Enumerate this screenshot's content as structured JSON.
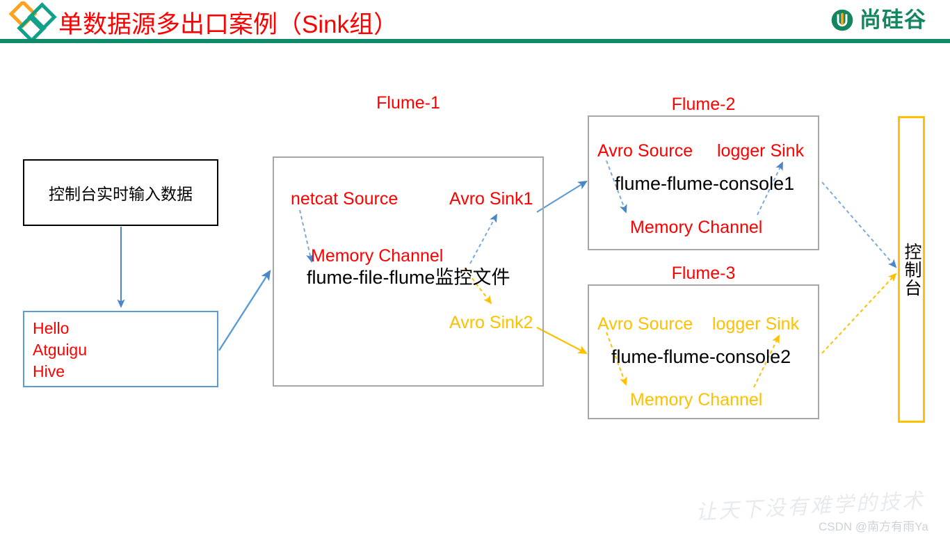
{
  "header": {
    "title": "单数据源多出口案例（Sink组）",
    "brand_logo_text": "尚硅谷",
    "brand_logo_mark": "u-circle-icon",
    "rule_color": "#0e8a6b",
    "title_color": "#ff0000",
    "brand_color": "#13855f",
    "diamond_colors": [
      "#ffa21f",
      "#11a08a",
      "#11a08a"
    ]
  },
  "diagram": {
    "console_input": {
      "label": "控制台实时输入数据",
      "border_color": "#000000"
    },
    "data_box": {
      "lines": [
        "Hello",
        "Atguigu",
        "Hive"
      ],
      "text_color": "#ff0000",
      "border_color": "#5b9bd5"
    },
    "flume1": {
      "title": "Flume-1",
      "source": "netcat Source",
      "channel": "Memory  Channel",
      "config_name": "flume-file-flume监控文件",
      "sink1": "Avro Sink1",
      "sink2": "Avro Sink2",
      "sink1_color": "#ff0000",
      "sink2_color": "#ffc000",
      "border_color": "#a6a6a6"
    },
    "flume2": {
      "title": "Flume-2",
      "source": "Avro Source",
      "sink": "logger Sink",
      "config_name": "flume-flume-console1",
      "channel": "Memory Channel",
      "accent_color": "#ff0000",
      "arrow_color": "#5b9bd5",
      "border_color": "#a6a6a6"
    },
    "flume3": {
      "title": "Flume-3",
      "source": "Avro Source",
      "sink": "logger Sink",
      "config_name": "flume-flume-console2",
      "channel": "Memory Channel",
      "accent_color": "#ffc000",
      "arrow_color": "#ffc000",
      "border_color": "#a6a6a6"
    },
    "console_output": {
      "label": "控制台",
      "border_color": "#ffc000"
    }
  },
  "watermark": {
    "slogan": "让天下没有难学的技术",
    "credit": "CSDN @南方有雨Ya"
  }
}
